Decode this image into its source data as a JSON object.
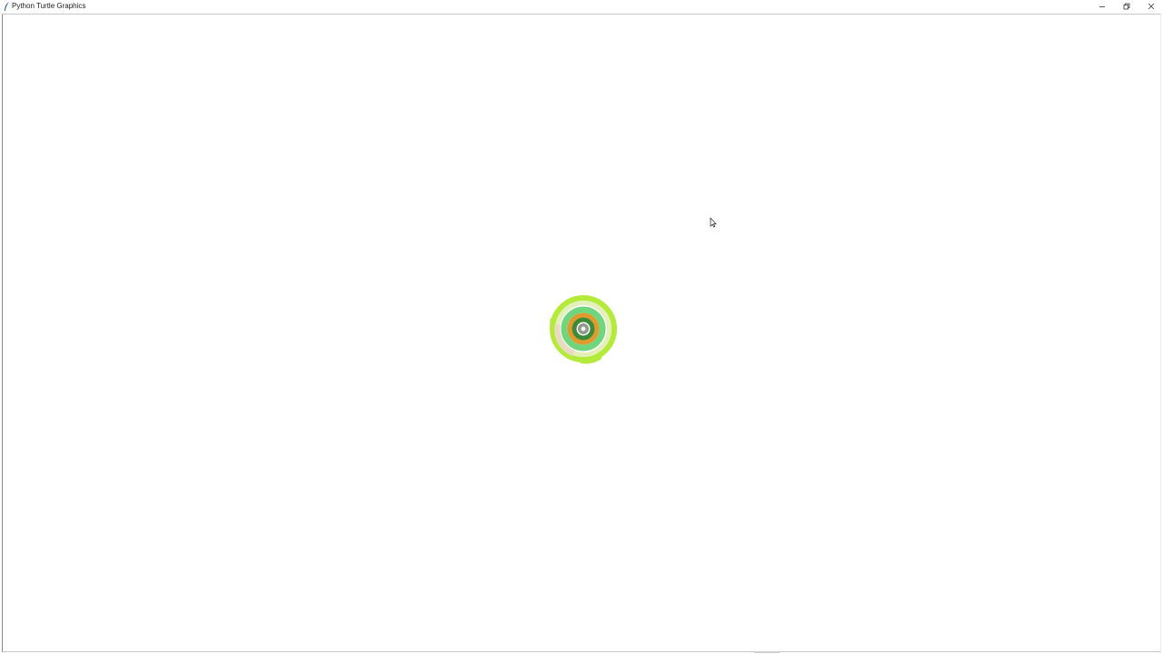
{
  "window": {
    "title": "Python Turtle Graphics",
    "controls": {
      "minimize_icon": "minimize-icon",
      "restore_icon": "restore-icon",
      "close_icon": "close-icon"
    }
  },
  "canvas": {
    "background": "#ffffff",
    "drawing": {
      "description_icon": "spiral-drawing",
      "colors": {
        "outer_ring": "#b4ea3a",
        "outer_inner_light": "#e3f0b8",
        "beige_patch": "#e8dcc0",
        "light_green_ring": "#6fd67e",
        "orange_ring": "#e39a2c",
        "dark_green_ring": "#3f8a37",
        "gray_center": "#8c9b8c",
        "center_dot": "#f4f4f4"
      }
    }
  }
}
